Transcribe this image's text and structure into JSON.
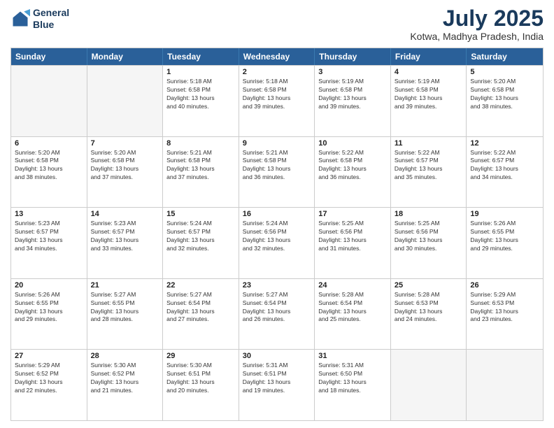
{
  "logo": {
    "line1": "General",
    "line2": "Blue"
  },
  "title": "July 2025",
  "location": "Kotwa, Madhya Pradesh, India",
  "header_days": [
    "Sunday",
    "Monday",
    "Tuesday",
    "Wednesday",
    "Thursday",
    "Friday",
    "Saturday"
  ],
  "weeks": [
    [
      {
        "day": "",
        "info": ""
      },
      {
        "day": "",
        "info": ""
      },
      {
        "day": "1",
        "info": "Sunrise: 5:18 AM\nSunset: 6:58 PM\nDaylight: 13 hours\nand 40 minutes."
      },
      {
        "day": "2",
        "info": "Sunrise: 5:18 AM\nSunset: 6:58 PM\nDaylight: 13 hours\nand 39 minutes."
      },
      {
        "day": "3",
        "info": "Sunrise: 5:19 AM\nSunset: 6:58 PM\nDaylight: 13 hours\nand 39 minutes."
      },
      {
        "day": "4",
        "info": "Sunrise: 5:19 AM\nSunset: 6:58 PM\nDaylight: 13 hours\nand 39 minutes."
      },
      {
        "day": "5",
        "info": "Sunrise: 5:20 AM\nSunset: 6:58 PM\nDaylight: 13 hours\nand 38 minutes."
      }
    ],
    [
      {
        "day": "6",
        "info": "Sunrise: 5:20 AM\nSunset: 6:58 PM\nDaylight: 13 hours\nand 38 minutes."
      },
      {
        "day": "7",
        "info": "Sunrise: 5:20 AM\nSunset: 6:58 PM\nDaylight: 13 hours\nand 37 minutes."
      },
      {
        "day": "8",
        "info": "Sunrise: 5:21 AM\nSunset: 6:58 PM\nDaylight: 13 hours\nand 37 minutes."
      },
      {
        "day": "9",
        "info": "Sunrise: 5:21 AM\nSunset: 6:58 PM\nDaylight: 13 hours\nand 36 minutes."
      },
      {
        "day": "10",
        "info": "Sunrise: 5:22 AM\nSunset: 6:58 PM\nDaylight: 13 hours\nand 36 minutes."
      },
      {
        "day": "11",
        "info": "Sunrise: 5:22 AM\nSunset: 6:57 PM\nDaylight: 13 hours\nand 35 minutes."
      },
      {
        "day": "12",
        "info": "Sunrise: 5:22 AM\nSunset: 6:57 PM\nDaylight: 13 hours\nand 34 minutes."
      }
    ],
    [
      {
        "day": "13",
        "info": "Sunrise: 5:23 AM\nSunset: 6:57 PM\nDaylight: 13 hours\nand 34 minutes."
      },
      {
        "day": "14",
        "info": "Sunrise: 5:23 AM\nSunset: 6:57 PM\nDaylight: 13 hours\nand 33 minutes."
      },
      {
        "day": "15",
        "info": "Sunrise: 5:24 AM\nSunset: 6:57 PM\nDaylight: 13 hours\nand 32 minutes."
      },
      {
        "day": "16",
        "info": "Sunrise: 5:24 AM\nSunset: 6:56 PM\nDaylight: 13 hours\nand 32 minutes."
      },
      {
        "day": "17",
        "info": "Sunrise: 5:25 AM\nSunset: 6:56 PM\nDaylight: 13 hours\nand 31 minutes."
      },
      {
        "day": "18",
        "info": "Sunrise: 5:25 AM\nSunset: 6:56 PM\nDaylight: 13 hours\nand 30 minutes."
      },
      {
        "day": "19",
        "info": "Sunrise: 5:26 AM\nSunset: 6:55 PM\nDaylight: 13 hours\nand 29 minutes."
      }
    ],
    [
      {
        "day": "20",
        "info": "Sunrise: 5:26 AM\nSunset: 6:55 PM\nDaylight: 13 hours\nand 29 minutes."
      },
      {
        "day": "21",
        "info": "Sunrise: 5:27 AM\nSunset: 6:55 PM\nDaylight: 13 hours\nand 28 minutes."
      },
      {
        "day": "22",
        "info": "Sunrise: 5:27 AM\nSunset: 6:54 PM\nDaylight: 13 hours\nand 27 minutes."
      },
      {
        "day": "23",
        "info": "Sunrise: 5:27 AM\nSunset: 6:54 PM\nDaylight: 13 hours\nand 26 minutes."
      },
      {
        "day": "24",
        "info": "Sunrise: 5:28 AM\nSunset: 6:54 PM\nDaylight: 13 hours\nand 25 minutes."
      },
      {
        "day": "25",
        "info": "Sunrise: 5:28 AM\nSunset: 6:53 PM\nDaylight: 13 hours\nand 24 minutes."
      },
      {
        "day": "26",
        "info": "Sunrise: 5:29 AM\nSunset: 6:53 PM\nDaylight: 13 hours\nand 23 minutes."
      }
    ],
    [
      {
        "day": "27",
        "info": "Sunrise: 5:29 AM\nSunset: 6:52 PM\nDaylight: 13 hours\nand 22 minutes."
      },
      {
        "day": "28",
        "info": "Sunrise: 5:30 AM\nSunset: 6:52 PM\nDaylight: 13 hours\nand 21 minutes."
      },
      {
        "day": "29",
        "info": "Sunrise: 5:30 AM\nSunset: 6:51 PM\nDaylight: 13 hours\nand 20 minutes."
      },
      {
        "day": "30",
        "info": "Sunrise: 5:31 AM\nSunset: 6:51 PM\nDaylight: 13 hours\nand 19 minutes."
      },
      {
        "day": "31",
        "info": "Sunrise: 5:31 AM\nSunset: 6:50 PM\nDaylight: 13 hours\nand 18 minutes."
      },
      {
        "day": "",
        "info": ""
      },
      {
        "day": "",
        "info": ""
      }
    ]
  ]
}
